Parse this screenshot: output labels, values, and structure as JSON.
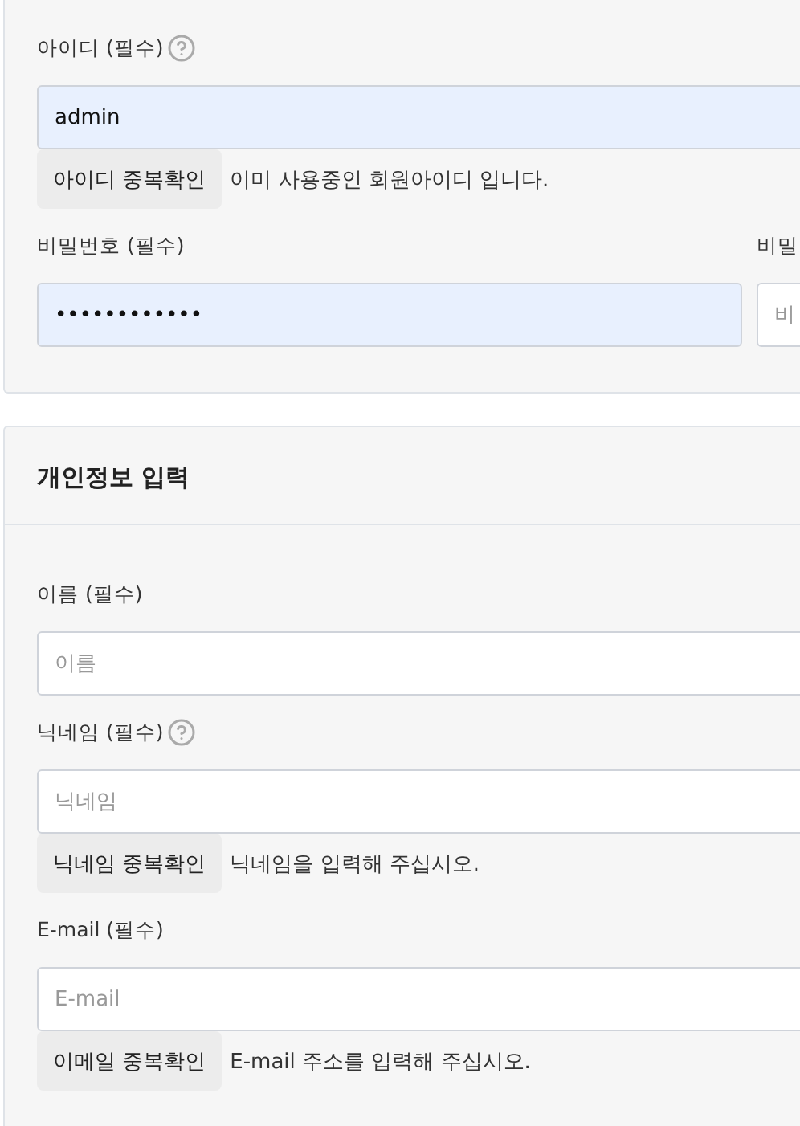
{
  "panels": [
    {
      "fields": [
        {
          "kind": "single",
          "label": "아이디 (필수)",
          "help": true,
          "value": "admin",
          "autofilled": true,
          "check_button": "아이디 중복확인",
          "message": "이미 사용중인 회원아이디 입니다."
        },
        {
          "kind": "pair",
          "items": [
            {
              "label": "비밀번호 (필수)",
              "value": "••••••••••••",
              "autofilled": true
            },
            {
              "label": "비밀",
              "placeholder": "비",
              "autofilled": false
            }
          ]
        }
      ]
    },
    {
      "title": "개인정보 입력",
      "fields": [
        {
          "kind": "single",
          "label": "이름 (필수)",
          "help": false,
          "placeholder": "이름",
          "autofilled": false
        },
        {
          "kind": "single",
          "label": "닉네임 (필수)",
          "help": true,
          "placeholder": "닉네임",
          "autofilled": false,
          "check_button": "닉네임 중복확인",
          "message": "닉네임을 입력해 주십시오."
        },
        {
          "kind": "single",
          "label": "E-mail (필수)",
          "help": false,
          "placeholder": "E-mail",
          "autofilled": false,
          "check_button": "이메일 중복확인",
          "message": "E-mail 주소를 입력해 주십시오."
        }
      ]
    }
  ]
}
